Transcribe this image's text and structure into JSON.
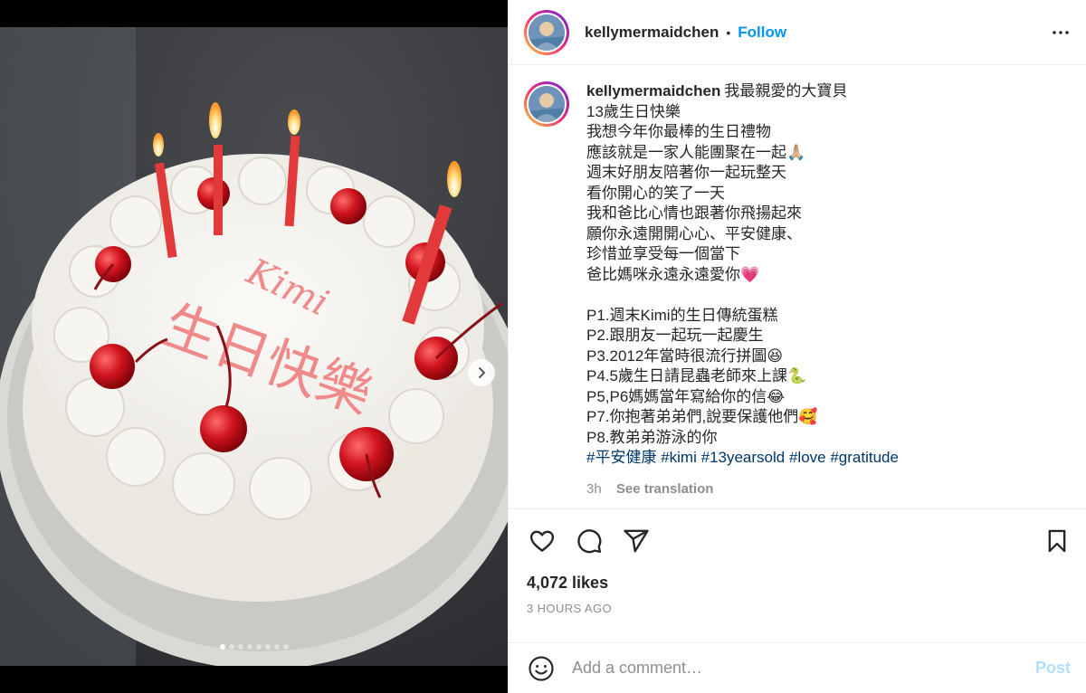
{
  "media": {
    "image_alt": "Birthday cake with candles and cherries",
    "cake_text": "Kimi 生日快樂",
    "carousel_count": 8,
    "carousel_active_index": 0
  },
  "header": {
    "username": "kellymermaidchen",
    "separator": "•",
    "follow_label": "Follow",
    "more_icon": "more-horizontal-icon"
  },
  "caption": {
    "username": "kellymermaidchen",
    "lines": [
      "我最親愛的大寶貝",
      "13歲生日快樂",
      "我想今年你最棒的生日禮物",
      "應該就是一家人能團聚在一起🙏🏼",
      "週末好朋友陪著你一起玩整天",
      "看你開心的笑了一天",
      "我和爸比心情也跟著你飛揚起來",
      "願你永遠開開心心、平安健康、",
      "珍惜並享受每一個當下",
      "爸比媽咪永遠永遠愛你💗",
      "",
      "P1.週末Kimi的生日傳統蛋糕",
      "P2.跟朋友一起玩一起慶生",
      "P3.2012年當時很流行拼圖😆",
      "P4.5歲生日請昆蟲老師來上課🐍",
      "P5,P6媽媽當年寫給你的信😂",
      "P7.你抱著弟弟們,說要保護他們🥰",
      "P8.教弟弟游泳的你"
    ],
    "hashtags": [
      "#平安健康",
      "#kimi",
      "#13yearsold",
      "#love",
      "#gratitude"
    ],
    "time": "3h",
    "see_translation": "See translation"
  },
  "actions": {
    "like_icon": "heart-icon",
    "comment_icon": "comment-icon",
    "share_icon": "share-icon",
    "save_icon": "bookmark-icon",
    "likes": "4,072 likes",
    "ago": "3 HOURS AGO"
  },
  "comment": {
    "placeholder": "Add a comment…",
    "post_label": "Post",
    "emoji_icon": "emoji-icon"
  },
  "colors": {
    "accent": "#0095f6",
    "hashtag": "#00376b",
    "muted": "#8e8e8e",
    "post_disabled": "#b2dffc"
  }
}
